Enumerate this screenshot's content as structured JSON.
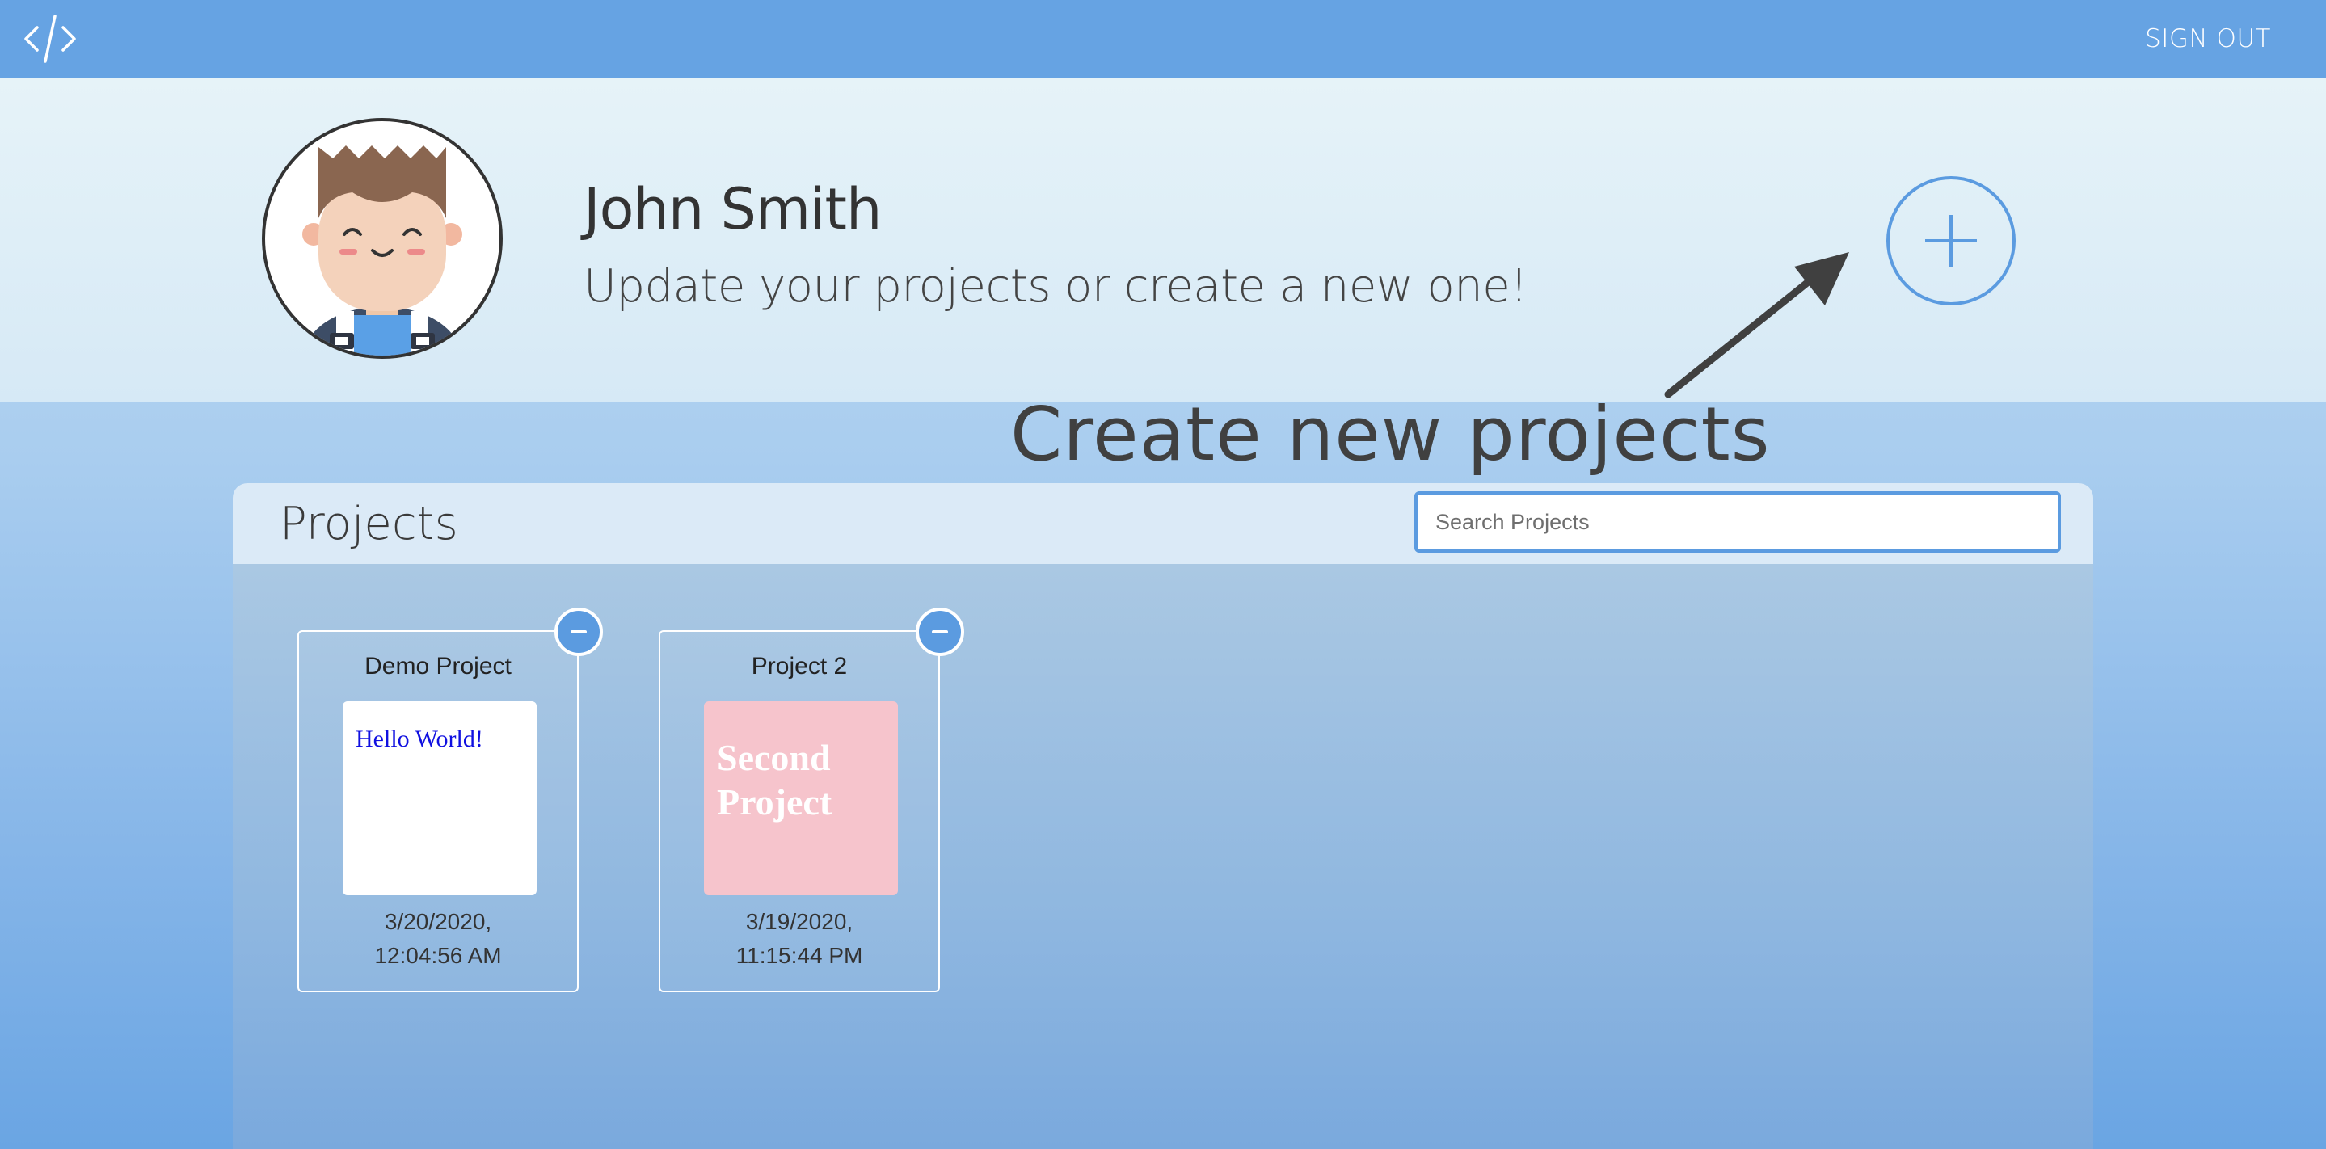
{
  "nav": {
    "logo_icon": "code-brackets-icon",
    "sign_out_label": "SIGN OUT"
  },
  "profile": {
    "name": "John Smith",
    "subtitle": "Update your projects or create a new one!",
    "avatar_icon": "boy-avatar-icon",
    "add_button_icon": "plus-icon"
  },
  "annotation": {
    "label": "Create new projects",
    "arrow_icon": "arrow-icon"
  },
  "projects": {
    "title": "Projects",
    "search_placeholder": "Search Projects",
    "items": [
      {
        "name": "Demo Project",
        "preview_text": "Hello World!",
        "date_line1": "3/20/2020,",
        "date_line2": "12:04:56 AM"
      },
      {
        "name": "Project 2",
        "preview_text": "Second Project",
        "date_line1": "3/19/2020,",
        "date_line2": "11:15:44 PM"
      }
    ]
  },
  "colors": {
    "nav_bg": "#66a3e3",
    "accent": "#5b9be0",
    "text_dark": "#333333"
  }
}
